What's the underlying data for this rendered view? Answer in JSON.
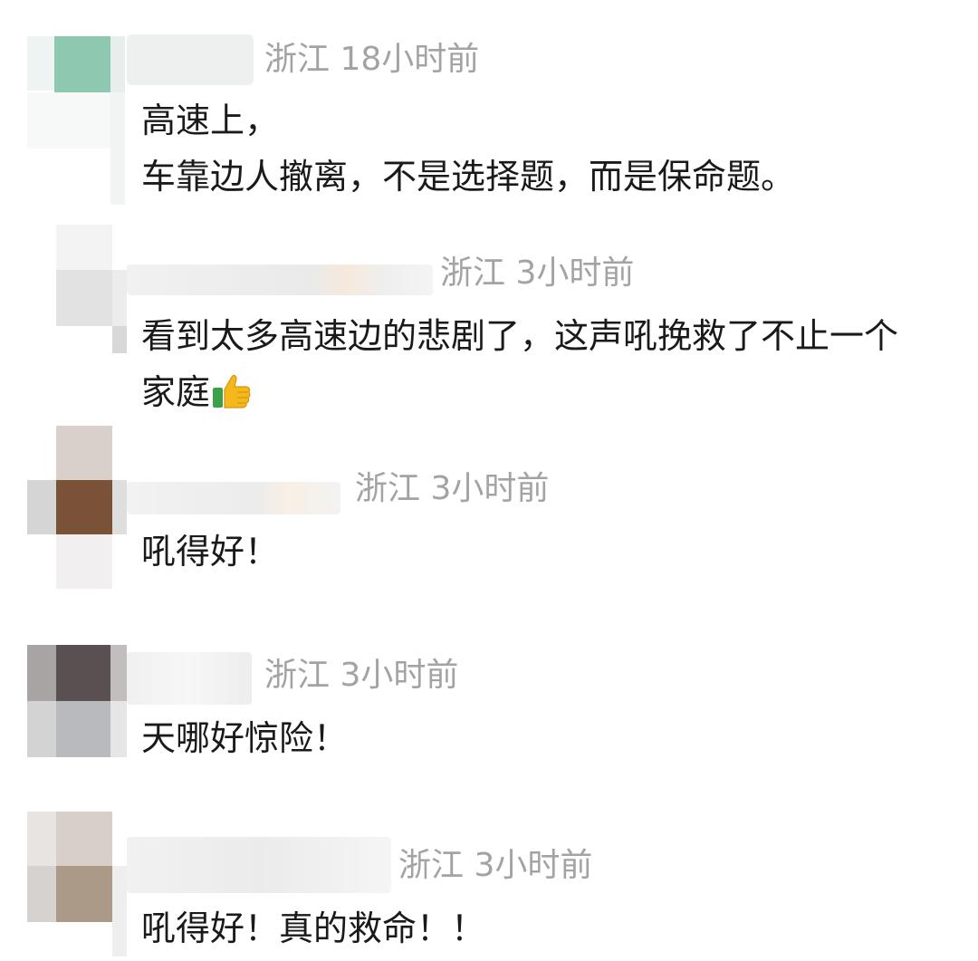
{
  "comments": [
    {
      "location": "浙江",
      "time": "18小时前",
      "lines": [
        "高速上，",
        "车靠边人撤离，不是选择题，而是保命题。"
      ]
    },
    {
      "location": "浙江",
      "time": "3小时前",
      "lines": [
        "看到太多高速边的悲剧了，这声吼挽救了不止一个",
        "家庭"
      ],
      "emoji": "thumbs-up-icon"
    },
    {
      "location": "浙江",
      "time": "3小时前",
      "lines": [
        "吼得好！"
      ]
    },
    {
      "location": "浙江",
      "time": "3小时前",
      "lines": [
        "天哪好惊险！"
      ]
    },
    {
      "location": "浙江",
      "time": "3小时前",
      "lines": [
        "吼得好！真的救命！！"
      ]
    }
  ],
  "colors": {
    "meta_text": "#a3a3a3",
    "body_text": "#1a1a1a",
    "emoji_green": "#3aa14a",
    "emoji_yellow": "#f5b81c"
  }
}
